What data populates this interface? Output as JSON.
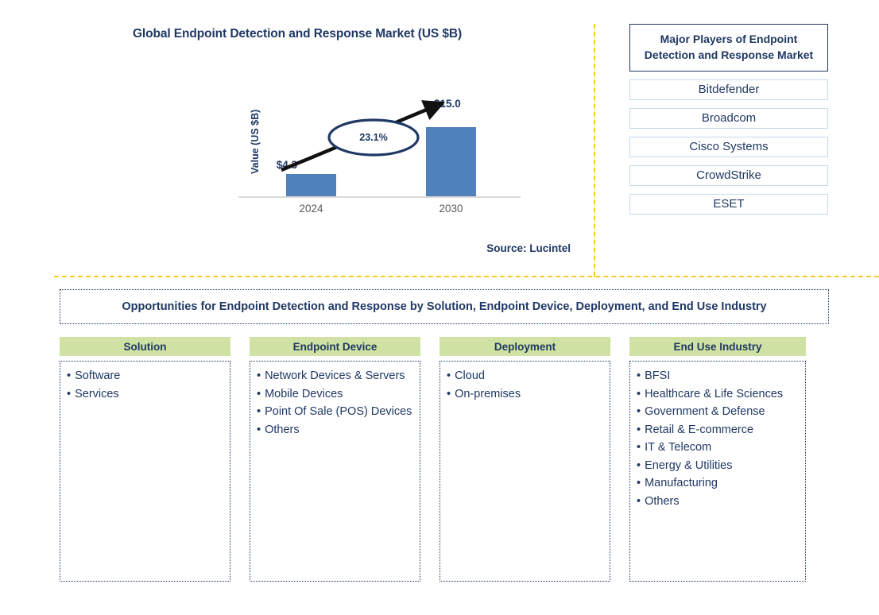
{
  "chart_panel": {
    "title": "Global Endpoint Detection and Response Market (US $B)",
    "y_axis_label": "Value (US $B)",
    "cagr_label": "23.1%",
    "source": "Source: Lucintel"
  },
  "chart_data": {
    "type": "bar",
    "title": "Global Endpoint Detection and Response Market (US $B)",
    "categories": [
      "2024",
      "2030"
    ],
    "values": [
      4.3,
      15.0
    ],
    "value_labels": [
      "$4.3",
      "$15.0"
    ],
    "xlabel": "",
    "ylabel": "Value (US $B)",
    "ylim": [
      0,
      17
    ],
    "grid": false,
    "legend": "none",
    "annotations": [
      {
        "text": "23.1%",
        "type": "cagr-callout",
        "from": "2024",
        "to": "2030"
      }
    ],
    "series_color": "#4f81bd",
    "source": "Source: Lucintel"
  },
  "players": {
    "header": "Major Players of Endpoint Detection and Response Market",
    "items": [
      "Bitdefender",
      "Broadcom",
      "Cisco Systems",
      "CrowdStrike",
      "ESET"
    ]
  },
  "opportunities": {
    "title": "Opportunities for Endpoint Detection and Response by Solution, Endpoint Device, Deployment, and End Use Industry"
  },
  "segments": [
    {
      "header": "Solution",
      "items": [
        "Software",
        "Services"
      ]
    },
    {
      "header": "Endpoint Device",
      "items": [
        "Network Devices & Servers",
        "Mobile Devices",
        "Point Of Sale (POS) Devices",
        "Others"
      ]
    },
    {
      "header": "Deployment",
      "items": [
        "Cloud",
        "On-premises"
      ]
    },
    {
      "header": "End Use Industry",
      "items": [
        "BFSI",
        "Healthcare & Life Sciences",
        "Government & Defense",
        "Retail & E-commerce",
        "IT & Telecom",
        "Energy & Utilities",
        "Manufacturing",
        "Others"
      ]
    }
  ],
  "colors": {
    "bar": "#4f81bd",
    "navy": "#1f3864",
    "green_header": "#cfe2a3",
    "divider_yellow": "#fec828",
    "player_border": "#c5d9ec"
  }
}
